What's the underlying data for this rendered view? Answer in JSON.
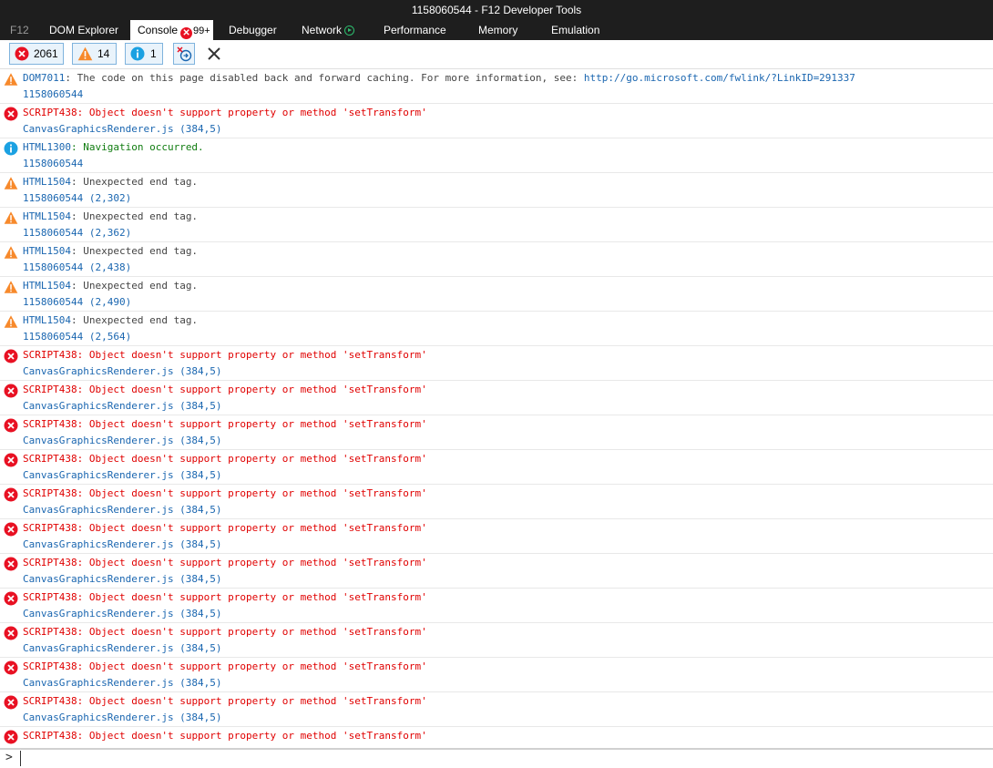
{
  "window": {
    "title": "1158060544 - F12 Developer Tools"
  },
  "tabs": [
    {
      "label": "F12"
    },
    {
      "label": "DOM Explorer"
    },
    {
      "label": "Console",
      "badge": "99+"
    },
    {
      "label": "Debugger"
    },
    {
      "label": "Network"
    },
    {
      "label": "Performance"
    },
    {
      "label": "Memory"
    },
    {
      "label": "Emulation"
    }
  ],
  "toolbar": {
    "errors_count": "2061",
    "warnings_count": "14",
    "info_count": "1"
  },
  "colors": {
    "error": "#e81123",
    "warning": "#f7892b",
    "info": "#1ba1e2",
    "link": "#1a66b0"
  },
  "messages": [
    {
      "level": "warning",
      "code": "DOM7011",
      "text": ": The code on this page disabled back and forward caching. For more information, see: ",
      "link": "http://go.microsoft.com/fwlink/?LinkID=291337",
      "source": "1158060544"
    },
    {
      "level": "error",
      "code": "SCRIPT438",
      "text": ": Object doesn't support property or method 'setTransform'",
      "link": "",
      "source": "CanvasGraphicsRenderer.js (384,5)"
    },
    {
      "level": "info",
      "code": "HTML1300",
      "text": ": Navigation occurred.",
      "link": "",
      "source": "1158060544"
    },
    {
      "level": "warning",
      "code": "HTML1504",
      "text": ": Unexpected end tag.",
      "link": "",
      "source": "1158060544 (2,302)"
    },
    {
      "level": "warning",
      "code": "HTML1504",
      "text": ": Unexpected end tag.",
      "link": "",
      "source": "1158060544 (2,362)"
    },
    {
      "level": "warning",
      "code": "HTML1504",
      "text": ": Unexpected end tag.",
      "link": "",
      "source": "1158060544 (2,438)"
    },
    {
      "level": "warning",
      "code": "HTML1504",
      "text": ": Unexpected end tag.",
      "link": "",
      "source": "1158060544 (2,490)"
    },
    {
      "level": "warning",
      "code": "HTML1504",
      "text": ": Unexpected end tag.",
      "link": "",
      "source": "1158060544 (2,564)"
    },
    {
      "level": "error",
      "code": "SCRIPT438",
      "text": ": Object doesn't support property or method 'setTransform'",
      "link": "",
      "source": "CanvasGraphicsRenderer.js (384,5)"
    },
    {
      "level": "error",
      "code": "SCRIPT438",
      "text": ": Object doesn't support property or method 'setTransform'",
      "link": "",
      "source": "CanvasGraphicsRenderer.js (384,5)"
    },
    {
      "level": "error",
      "code": "SCRIPT438",
      "text": ": Object doesn't support property or method 'setTransform'",
      "link": "",
      "source": "CanvasGraphicsRenderer.js (384,5)"
    },
    {
      "level": "error",
      "code": "SCRIPT438",
      "text": ": Object doesn't support property or method 'setTransform'",
      "link": "",
      "source": "CanvasGraphicsRenderer.js (384,5)"
    },
    {
      "level": "error",
      "code": "SCRIPT438",
      "text": ": Object doesn't support property or method 'setTransform'",
      "link": "",
      "source": "CanvasGraphicsRenderer.js (384,5)"
    },
    {
      "level": "error",
      "code": "SCRIPT438",
      "text": ": Object doesn't support property or method 'setTransform'",
      "link": "",
      "source": "CanvasGraphicsRenderer.js (384,5)"
    },
    {
      "level": "error",
      "code": "SCRIPT438",
      "text": ": Object doesn't support property or method 'setTransform'",
      "link": "",
      "source": "CanvasGraphicsRenderer.js (384,5)"
    },
    {
      "level": "error",
      "code": "SCRIPT438",
      "text": ": Object doesn't support property or method 'setTransform'",
      "link": "",
      "source": "CanvasGraphicsRenderer.js (384,5)"
    },
    {
      "level": "error",
      "code": "SCRIPT438",
      "text": ": Object doesn't support property or method 'setTransform'",
      "link": "",
      "source": "CanvasGraphicsRenderer.js (384,5)"
    },
    {
      "level": "error",
      "code": "SCRIPT438",
      "text": ": Object doesn't support property or method 'setTransform'",
      "link": "",
      "source": "CanvasGraphicsRenderer.js (384,5)"
    },
    {
      "level": "error",
      "code": "SCRIPT438",
      "text": ": Object doesn't support property or method 'setTransform'",
      "link": "",
      "source": "CanvasGraphicsRenderer.js (384,5)"
    },
    {
      "level": "error",
      "code": "SCRIPT438",
      "text": ": Object doesn't support property or method 'setTransform'",
      "link": "",
      "source": ""
    }
  ],
  "input": {
    "prompt": ">",
    "value": ""
  }
}
